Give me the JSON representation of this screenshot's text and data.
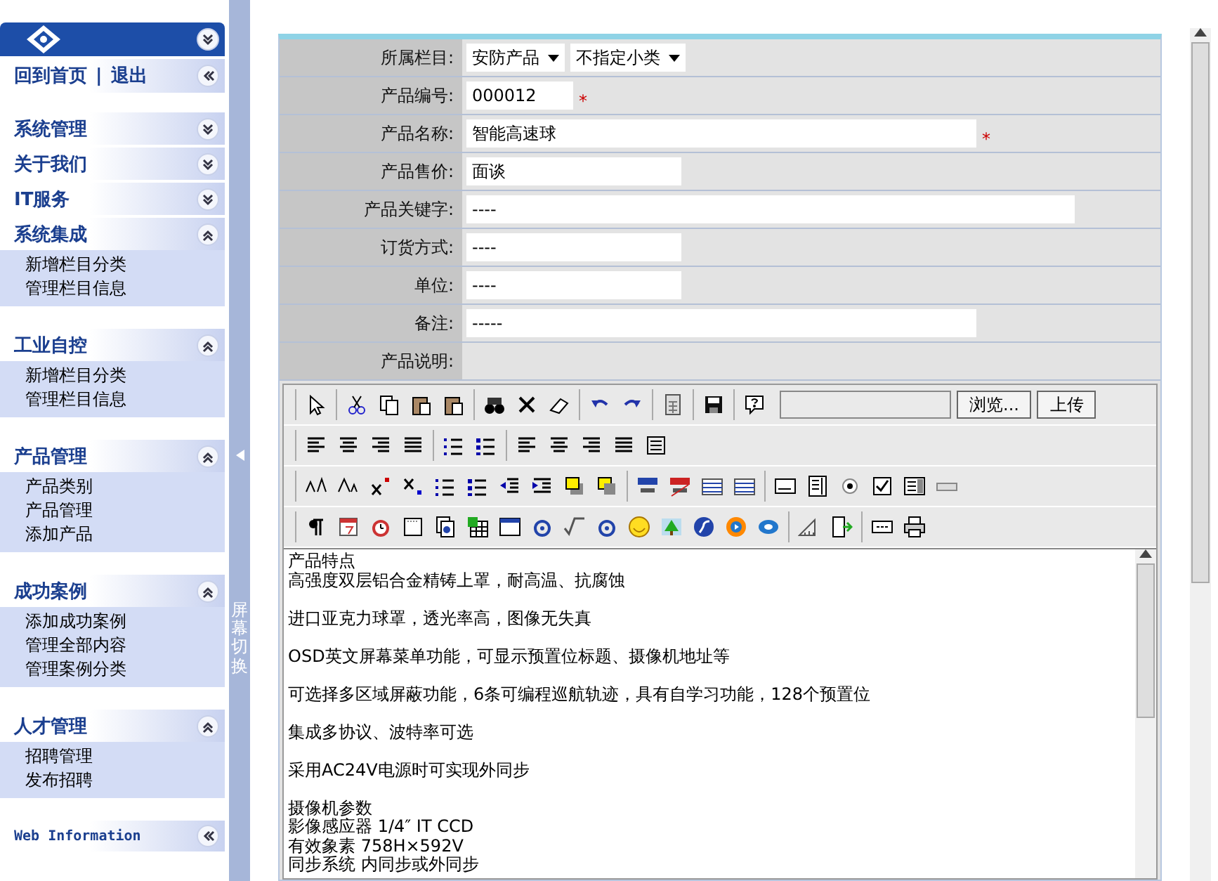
{
  "sidebar": {
    "home_link": "回到首页",
    "separator": "|",
    "logout_link": "退出",
    "groups": [
      {
        "title": "系统管理",
        "expanded": false
      },
      {
        "title": "关于我们",
        "expanded": false
      },
      {
        "title": "IT服务",
        "expanded": false
      },
      {
        "title": "系统集成",
        "expanded": true,
        "items": [
          "新增栏目分类",
          "管理栏目信息"
        ]
      },
      {
        "title": "工业自控",
        "expanded": true,
        "items": [
          "新增栏目分类",
          "管理栏目信息"
        ]
      },
      {
        "title": "产品管理",
        "expanded": true,
        "items": [
          "产品类别",
          "产品管理",
          "添加产品"
        ]
      },
      {
        "title": "成功案例",
        "expanded": true,
        "items": [
          "添加成功案例",
          "管理全部内容",
          "管理案例分类"
        ]
      },
      {
        "title": "人才管理",
        "expanded": true,
        "items": [
          "招聘管理",
          "发布招聘"
        ]
      }
    ],
    "footer_link": "Web Information"
  },
  "splitter": {
    "label": "屏幕切换"
  },
  "form": {
    "fields": [
      {
        "label": "所属栏目:",
        "kind": "select",
        "selects": [
          "安防产品",
          "不指定小类"
        ]
      },
      {
        "label": "产品编号:",
        "kind": "short",
        "value": "000012",
        "required_mark": "*"
      },
      {
        "label": "产品名称:",
        "kind": "wide",
        "value": "智能高速球",
        "required_mark": "*"
      },
      {
        "label": "产品售价:",
        "kind": "medium",
        "value": "面谈"
      },
      {
        "label": "产品关键字:",
        "kind": "long",
        "value": "----"
      },
      {
        "label": "订货方式:",
        "kind": "medium",
        "value": "----"
      },
      {
        "label": "单位:",
        "kind": "medium",
        "value": "----"
      },
      {
        "label": "备注:",
        "kind": "wide",
        "value": "-----"
      },
      {
        "label": "产品说明:",
        "kind": "none"
      }
    ]
  },
  "editor": {
    "browse_button": "浏览...",
    "upload_button": "上传",
    "paragraphs": [
      {
        "lines": [
          "产品特点",
          "高强度双层铝合金精铸上罩，耐高温、抗腐蚀"
        ]
      },
      {
        "lines": [
          "进口亚克力球罩，透光率高，图像无失真"
        ]
      },
      {
        "lines": [
          "OSD英文屏幕菜单功能，可显示预置位标题、摄像机地址等"
        ]
      },
      {
        "lines": [
          "可选择多区域屏蔽功能，6条可编程巡航轨迹，具有自学习功能，128个预置位"
        ]
      },
      {
        "lines": [
          "集成多协议、波特率可选"
        ]
      },
      {
        "lines": [
          "采用AC24V电源时可实现外同步"
        ]
      },
      {
        "lines": [
          "摄像机参数",
          "影像感应器 1/4″ IT CCD",
          "有效象素 758H×592V",
          "同步系统 内同步或外同步"
        ]
      }
    ]
  }
}
